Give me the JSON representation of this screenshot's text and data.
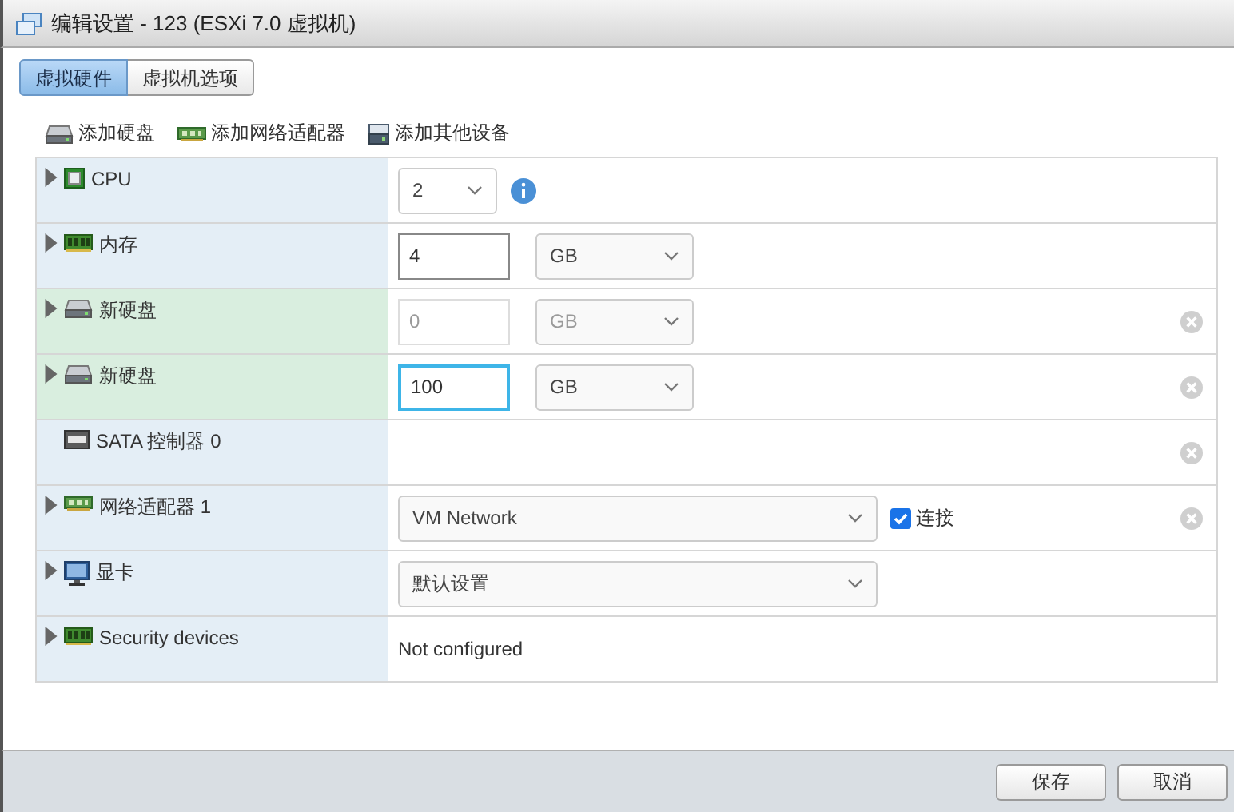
{
  "window": {
    "title": "编辑设置 - 123 (ESXi 7.0 虚拟机)"
  },
  "tabs": [
    {
      "label": "虚拟硬件",
      "selected": true
    },
    {
      "label": "虚拟机选项",
      "selected": false
    }
  ],
  "toolbar": [
    {
      "label": "添加硬盘",
      "kind": "disk"
    },
    {
      "label": "添加网络适配器",
      "kind": "nic"
    },
    {
      "label": "添加其他设备",
      "kind": "device"
    }
  ],
  "rows": [
    {
      "label": "CPU",
      "kind": "cpu",
      "expandable": true,
      "highlighted": false,
      "removable": false,
      "value": "2",
      "info": true
    },
    {
      "label": "内存",
      "kind": "memory",
      "expandable": true,
      "highlighted": false,
      "removable": false,
      "value": "4",
      "unit": "GB",
      "disabled": false,
      "focused": false
    },
    {
      "label": "新硬盘",
      "kind": "disk",
      "expandable": true,
      "highlighted": true,
      "removable": true,
      "value": "0",
      "unit": "GB",
      "disabled": true,
      "focused": false
    },
    {
      "label": "新硬盘",
      "kind": "disk",
      "expandable": true,
      "highlighted": true,
      "removable": true,
      "value": "100",
      "unit": "GB",
      "disabled": false,
      "focused": true
    },
    {
      "label": "SATA 控制器 0",
      "kind": "sata",
      "expandable": false,
      "highlighted": false,
      "removable": true
    },
    {
      "label": "网络适配器 1",
      "kind": "nic",
      "expandable": true,
      "highlighted": false,
      "removable": true,
      "value": "VM Network",
      "connect": {
        "label": "连接",
        "checked": true
      }
    },
    {
      "label": "显卡",
      "kind": "monitor",
      "expandable": true,
      "highlighted": false,
      "removable": false,
      "value": "默认设置"
    },
    {
      "label": "Security devices",
      "kind": "security",
      "expandable": true,
      "highlighted": false,
      "removable": false,
      "value": "Not configured"
    }
  ],
  "buttons": [
    {
      "label": "保存"
    },
    {
      "label": "取消"
    }
  ]
}
